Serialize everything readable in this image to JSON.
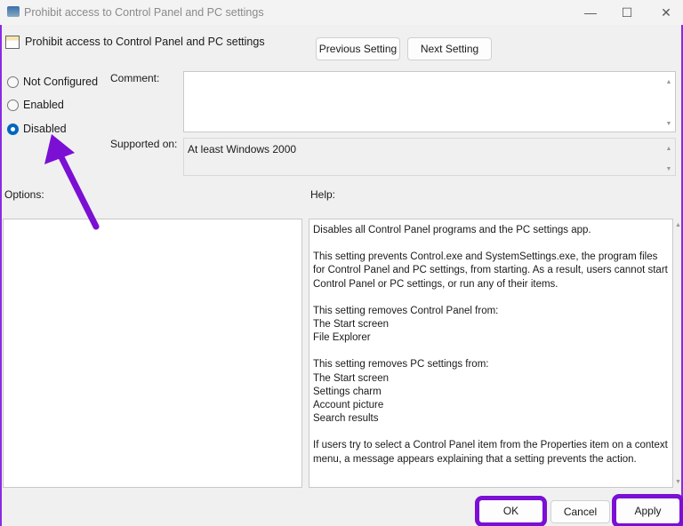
{
  "window": {
    "title": "Prohibit access to Control Panel and PC settings",
    "minimize": "—",
    "maximize": "☐",
    "close": "✕"
  },
  "header": {
    "title": "Prohibit access to Control Panel and PC settings",
    "previous": "Previous Setting",
    "next": "Next Setting"
  },
  "state": {
    "options": [
      {
        "label": "Not Configured",
        "selected": false
      },
      {
        "label": "Enabled",
        "selected": false
      },
      {
        "label": "Disabled",
        "selected": true
      }
    ]
  },
  "comment": {
    "label": "Comment:",
    "value": ""
  },
  "supported": {
    "label": "Supported on:",
    "value": "At least Windows 2000"
  },
  "options_label": "Options:",
  "help_label": "Help:",
  "help": {
    "p1": "Disables all Control Panel programs and the PC settings app.",
    "p2": "This setting prevents Control.exe and SystemSettings.exe, the program files for Control Panel and PC settings, from starting. As a result, users cannot start Control Panel or PC settings, or run any of their items.",
    "p3": [
      "This setting removes Control Panel from:",
      "The Start screen",
      "File Explorer"
    ],
    "p4": [
      "This setting removes PC settings from:",
      "The Start screen",
      "Settings charm",
      "Account picture",
      "Search results"
    ],
    "p5": "If users try to select a Control Panel item from the Properties item on a context menu, a message appears explaining that a setting prevents the action."
  },
  "footer": {
    "ok": "OK",
    "cancel": "Cancel",
    "apply": "Apply"
  },
  "colors": {
    "annotation": "#7b0fd4",
    "accent": "#0067c0"
  }
}
